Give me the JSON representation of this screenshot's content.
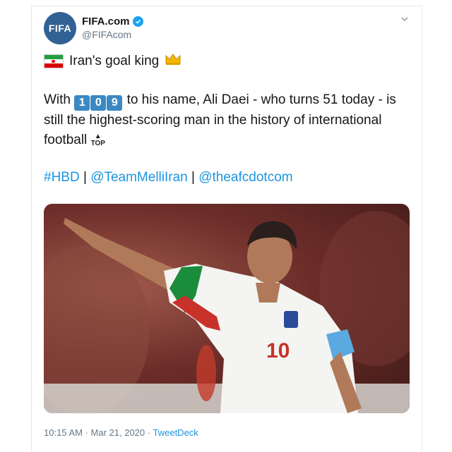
{
  "tweet": {
    "author_name": "FIFA.com",
    "author_handle": "@FIFAcom",
    "avatar_text": "FIFA",
    "title_line": "Iran's goal king",
    "body_prefix": "With",
    "number_digits": [
      "1",
      "0",
      "9"
    ],
    "body_suffix": "to his name, Ali Daei - who turns 51 today - is still the highest-scoring man in the history of international football",
    "top_icon_label": "TOP",
    "hashtag": "#HBD",
    "mention_1": "@TeamMelliIran",
    "mention_2": "@theafcdotcom",
    "separator": "|",
    "jersey_number": "10",
    "time": "10:15 AM",
    "date": "Mar 21, 2020",
    "dot": "·",
    "source": "TweetDeck"
  },
  "icons": {
    "verified": "verified-badge-icon",
    "menu": "chevron-down-icon",
    "flag": "iran-flag-icon",
    "crown": "crown-icon"
  },
  "colors": {
    "brand_blue": "#1da1f2",
    "link_blue": "#1b95e0",
    "avatar_bg": "#326295",
    "number_tile": "#3b88c3"
  }
}
